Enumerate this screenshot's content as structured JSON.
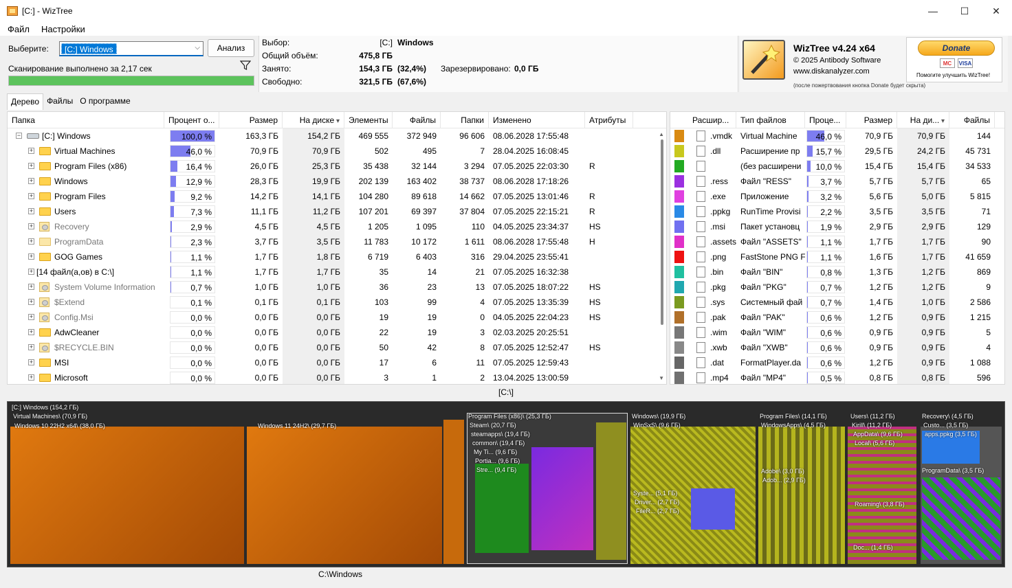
{
  "window": {
    "title": "[C:]  - WizTree",
    "controls": [
      "—",
      "☐",
      "✕"
    ]
  },
  "menu": [
    "Файл",
    "Настройки"
  ],
  "selector": {
    "label": "Выберите:",
    "value": "[C:] Windows",
    "analyze_label": "Анализ",
    "scan_status": "Сканирование выполнено за 2,17 сек",
    "progress": 1.0
  },
  "info": {
    "selection_label": "Выбор:",
    "selection_drive": "[C:]",
    "selection_name": "Windows",
    "total_label": "Общий объём:",
    "total_value": "475,8 ГБ",
    "used_label": "Занято:",
    "used_value": "154,3 ГБ",
    "used_pct": "(32,4%)",
    "reserved_label": "Зарезервировано:",
    "reserved_value": "0,0 ГБ",
    "free_label": "Свободно:",
    "free_value": "321,5 ГБ",
    "free_pct": "(67,6%)"
  },
  "brand": {
    "title": "WizTree v4.24 x64",
    "copyright": "© 2025 Antibody Software",
    "site": "www.diskanalyzer.com",
    "donate": "Donate",
    "card1": "MC",
    "card2": "VISA",
    "help": "Помогите улучшить WizTree!",
    "note": "(после пожертвования кнопка Donate будет скрыта)"
  },
  "tabs": [
    "Дерево",
    "Файлы",
    "О программе"
  ],
  "tree": {
    "headers": [
      "Папка",
      "Процент о...",
      "Размер",
      "На диске",
      "Элементы",
      "Файлы",
      "Папки",
      "Изменено",
      "Атрибуты"
    ],
    "rows": [
      {
        "name": "[C:] Windows",
        "pct": "100,0 %",
        "pctv": 1.0,
        "size": "163,3 ГБ",
        "disk": "154,2 ГБ",
        "items": "469 555",
        "files": "372 949",
        "folders": "96 606",
        "modified": "08.06.2028 17:55:48",
        "attr": "",
        "icon": "drive",
        "level": 0,
        "dim": false
      },
      {
        "name": "Virtual Machines",
        "pct": "46,0 %",
        "pctv": 0.46,
        "size": "70,9 ГБ",
        "disk": "70,9 ГБ",
        "items": "502",
        "files": "495",
        "folders": "7",
        "modified": "28.04.2025 16:08:45",
        "attr": "",
        "icon": "folder",
        "level": 1,
        "dim": false
      },
      {
        "name": "Program Files (x86)",
        "pct": "16,4 %",
        "pctv": 0.164,
        "size": "26,0 ГБ",
        "disk": "25,3 ГБ",
        "items": "35 438",
        "files": "32 144",
        "folders": "3 294",
        "modified": "07.05.2025 22:03:30",
        "attr": "R",
        "icon": "folder",
        "level": 1,
        "dim": false
      },
      {
        "name": "Windows",
        "pct": "12,9 %",
        "pctv": 0.129,
        "size": "28,3 ГБ",
        "disk": "19,9 ГБ",
        "items": "202 139",
        "files": "163 402",
        "folders": "38 737",
        "modified": "08.06.2028 17:18:26",
        "attr": "",
        "icon": "folder",
        "level": 1,
        "dim": false
      },
      {
        "name": "Program Files",
        "pct": "9,2 %",
        "pctv": 0.092,
        "size": "14,2 ГБ",
        "disk": "14,1 ГБ",
        "items": "104 280",
        "files": "89 618",
        "folders": "14 662",
        "modified": "07.05.2025 13:01:46",
        "attr": "R",
        "icon": "folder",
        "level": 1,
        "dim": false
      },
      {
        "name": "Users",
        "pct": "7,3 %",
        "pctv": 0.073,
        "size": "11,1 ГБ",
        "disk": "11,2 ГБ",
        "items": "107 201",
        "files": "69 397",
        "folders": "37 804",
        "modified": "07.05.2025 22:15:21",
        "attr": "R",
        "icon": "folder",
        "level": 1,
        "dim": false
      },
      {
        "name": "Recovery",
        "pct": "2,9 %",
        "pctv": 0.029,
        "size": "4,5 ГБ",
        "disk": "4,5 ГБ",
        "items": "1 205",
        "files": "1 095",
        "folders": "110",
        "modified": "04.05.2025 23:34:37",
        "attr": "HS",
        "icon": "gear",
        "level": 1,
        "dim": true
      },
      {
        "name": "ProgramData",
        "pct": "2,3 %",
        "pctv": 0.023,
        "size": "3,7 ГБ",
        "disk": "3,5 ГБ",
        "items": "11 783",
        "files": "10 172",
        "folders": "1 611",
        "modified": "08.06.2028 17:55:48",
        "attr": "H",
        "icon": "folderdim",
        "level": 1,
        "dim": true
      },
      {
        "name": "GOG Games",
        "pct": "1,1 %",
        "pctv": 0.011,
        "size": "1,7 ГБ",
        "disk": "1,8 ГБ",
        "items": "6 719",
        "files": "6 403",
        "folders": "316",
        "modified": "29.04.2025 23:55:41",
        "attr": "",
        "icon": "folder",
        "level": 1,
        "dim": false
      },
      {
        "name": "[14 файл(а,ов) в C:\\]",
        "pct": "1,1 %",
        "pctv": 0.011,
        "size": "1,7 ГБ",
        "disk": "1,7 ГБ",
        "items": "35",
        "files": "14",
        "folders": "21",
        "modified": "07.05.2025 16:32:38",
        "attr": "",
        "icon": "none",
        "level": 1,
        "dim": false
      },
      {
        "name": "System Volume Information",
        "pct": "0,7 %",
        "pctv": 0.007,
        "size": "1,0 ГБ",
        "disk": "1,0 ГБ",
        "items": "36",
        "files": "23",
        "folders": "13",
        "modified": "07.05.2025 18:07:22",
        "attr": "HS",
        "icon": "gear",
        "level": 1,
        "dim": true
      },
      {
        "name": "$Extend",
        "pct": "0,1 %",
        "pctv": 0.001,
        "size": "0,1 ГБ",
        "disk": "0,1 ГБ",
        "items": "103",
        "files": "99",
        "folders": "4",
        "modified": "07.05.2025 13:35:39",
        "attr": "HS",
        "icon": "gear",
        "level": 1,
        "dim": true
      },
      {
        "name": "Config.Msi",
        "pct": "0,0 %",
        "pctv": 0.0,
        "size": "0,0 ГБ",
        "disk": "0,0 ГБ",
        "items": "19",
        "files": "19",
        "folders": "0",
        "modified": "04.05.2025 22:04:23",
        "attr": "HS",
        "icon": "gear",
        "level": 1,
        "dim": true
      },
      {
        "name": "AdwCleaner",
        "pct": "0,0 %",
        "pctv": 0.0,
        "size": "0,0 ГБ",
        "disk": "0,0 ГБ",
        "items": "22",
        "files": "19",
        "folders": "3",
        "modified": "02.03.2025 20:25:51",
        "attr": "",
        "icon": "folder",
        "level": 1,
        "dim": false
      },
      {
        "name": "$RECYCLE.BIN",
        "pct": "0,0 %",
        "pctv": 0.0,
        "size": "0,0 ГБ",
        "disk": "0,0 ГБ",
        "items": "50",
        "files": "42",
        "folders": "8",
        "modified": "07.05.2025 12:52:47",
        "attr": "HS",
        "icon": "gear",
        "level": 1,
        "dim": true
      },
      {
        "name": "MSI",
        "pct": "0,0 %",
        "pctv": 0.0,
        "size": "0,0 ГБ",
        "disk": "0,0 ГБ",
        "items": "17",
        "files": "6",
        "folders": "11",
        "modified": "07.05.2025 12:59:43",
        "attr": "",
        "icon": "folder",
        "level": 1,
        "dim": false
      },
      {
        "name": "Microsoft",
        "pct": "0,0 %",
        "pctv": 0.0,
        "size": "0,0 ГБ",
        "disk": "0,0 ГБ",
        "items": "3",
        "files": "1",
        "folders": "2",
        "modified": "13.04.2025 13:00:59",
        "attr": "",
        "icon": "folder",
        "level": 1,
        "dim": false
      }
    ]
  },
  "ext": {
    "headers": [
      "Расшир...",
      "Тип файлов",
      "Проце...",
      "Размер",
      "На ди...",
      "Файлы"
    ],
    "rows": [
      {
        "color": "#d98a12",
        "ext": ".vmdk",
        "type": "Virtual Machine",
        "pct": "46,0 %",
        "pctv": 0.46,
        "size": "70,9 ГБ",
        "disk": "70,9 ГБ",
        "files": "144"
      },
      {
        "color": "#c8c81e",
        "ext": ".dll",
        "type": "Расширение пр",
        "pct": "15,7 %",
        "pctv": 0.157,
        "size": "29,5 ГБ",
        "disk": "24,2 ГБ",
        "files": "45 731"
      },
      {
        "color": "#22aa22",
        "ext": "",
        "type": "(без расширени",
        "pct": "10,0 %",
        "pctv": 0.1,
        "size": "15,4 ГБ",
        "disk": "15,4 ГБ",
        "files": "34 533"
      },
      {
        "color": "#9b30e0",
        "ext": ".ress",
        "type": "Файл \"RESS\"",
        "pct": "3,7 %",
        "pctv": 0.037,
        "size": "5,7 ГБ",
        "disk": "5,7 ГБ",
        "files": "65"
      },
      {
        "color": "#e040e0",
        "ext": ".exe",
        "type": "Приложение",
        "pct": "3,2 %",
        "pctv": 0.032,
        "size": "5,6 ГБ",
        "disk": "5,0 ГБ",
        "files": "5 815"
      },
      {
        "color": "#2a8ae6",
        "ext": ".ppkg",
        "type": "RunTime Provisi",
        "pct": "2,2 %",
        "pctv": 0.022,
        "size": "3,5 ГБ",
        "disk": "3,5 ГБ",
        "files": "71"
      },
      {
        "color": "#7070f0",
        "ext": ".msi",
        "type": "Пакет установц",
        "pct": "1,9 %",
        "pctv": 0.019,
        "size": "2,9 ГБ",
        "disk": "2,9 ГБ",
        "files": "129"
      },
      {
        "color": "#e030c8",
        "ext": ".assets",
        "type": "Файл \"ASSETS\"",
        "pct": "1,1 %",
        "pctv": 0.011,
        "size": "1,7 ГБ",
        "disk": "1,7 ГБ",
        "files": "90"
      },
      {
        "color": "#ee1111",
        "ext": ".png",
        "type": "FastStone PNG F",
        "pct": "1,1 %",
        "pctv": 0.011,
        "size": "1,6 ГБ",
        "disk": "1,7 ГБ",
        "files": "41 659"
      },
      {
        "color": "#20c0a0",
        "ext": ".bin",
        "type": "Файл \"BIN\"",
        "pct": "0,8 %",
        "pctv": 0.008,
        "size": "1,3 ГБ",
        "disk": "1,2 ГБ",
        "files": "869"
      },
      {
        "color": "#20a8b0",
        "ext": ".pkg",
        "type": "Файл \"PKG\"",
        "pct": "0,7 %",
        "pctv": 0.007,
        "size": "1,2 ГБ",
        "disk": "1,2 ГБ",
        "files": "9"
      },
      {
        "color": "#7a9a20",
        "ext": ".sys",
        "type": "Системный фай",
        "pct": "0,7 %",
        "pctv": 0.007,
        "size": "1,4 ГБ",
        "disk": "1,0 ГБ",
        "files": "2 586"
      },
      {
        "color": "#b0702a",
        "ext": ".pak",
        "type": "Файл \"PAK\"",
        "pct": "0,6 %",
        "pctv": 0.006,
        "size": "1,2 ГБ",
        "disk": "0,9 ГБ",
        "files": "1 215"
      },
      {
        "color": "#777777",
        "ext": ".wim",
        "type": "Файл \"WIM\"",
        "pct": "0,6 %",
        "pctv": 0.006,
        "size": "0,9 ГБ",
        "disk": "0,9 ГБ",
        "files": "5"
      },
      {
        "color": "#888888",
        "ext": ".xwb",
        "type": "Файл \"XWB\"",
        "pct": "0,6 %",
        "pctv": 0.006,
        "size": "0,9 ГБ",
        "disk": "0,9 ГБ",
        "files": "4"
      },
      {
        "color": "#666666",
        "ext": ".dat",
        "type": "FormatPlayer.da",
        "pct": "0,6 %",
        "pctv": 0.006,
        "size": "1,2 ГБ",
        "disk": "0,9 ГБ",
        "files": "1 088"
      },
      {
        "color": "#707070",
        "ext": ".mp4",
        "type": "Файл \"MP4\"",
        "pct": "0,5 %",
        "pctv": 0.005,
        "size": "0,8 ГБ",
        "disk": "0,8 ГБ",
        "files": "596"
      }
    ]
  },
  "treemap": {
    "hover_path": "[C:\\]",
    "status_path": "C:\\Windows",
    "labels": [
      "[C:] Windows  (154,2 ГБ)",
      "Virtual Machines\\ (70,9 ГБ)",
      "Windows 10 22H2 x64\\ (38,0 ГБ)",
      "Windows 11 24H2\\ (29,7 ГБ)",
      "Program Files (x86)\\ (25,3 ГБ)",
      "Steam\\ (20,7 ГБ)",
      "steamapps\\ (19,4 ГБ)",
      "common\\ (19,4 ГБ)",
      "My Ti... (9,6 ГБ)",
      "Portia... (9,6 ГБ)",
      "Stre... (9,4 ГБ)",
      "Windows\\ (19,9 ГБ)",
      "WinSxS\\ (9,6 ГБ)",
      "Syste... (5,1 ГБ)",
      "Driver... (2,7 ГБ)",
      "FileR... (2,7 ГБ)",
      "Program Files\\ (14,1 ГБ)",
      "WindowsApps\\ (4,5 ГБ)",
      "Adobe\\ (3,0 ГБ)",
      "Adob... (2,9 ГБ)",
      "Users\\ (11,2 ГБ)",
      "Kirill\\ (11,2 ГБ)",
      "AppData\\ (9,6 ГБ)",
      "Local\\ (5,6 ГБ)",
      "Roaming\\ (3,8 ГБ)",
      "Doc... (1,4 ГБ)",
      "Recovery\\ (4,5 ГБ)",
      "Custo... (3,5 ГБ)",
      "apps.ppkg (3,5 ГБ)",
      "ProgramData\\ (3,5 ГБ)"
    ]
  }
}
